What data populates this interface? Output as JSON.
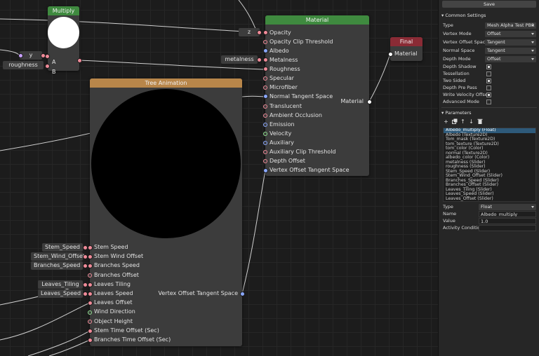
{
  "nodes": {
    "multiply": {
      "title": "Multiply",
      "inputs": [
        "A",
        "B"
      ],
      "header_color": "#3f8a3f"
    },
    "material": {
      "title": "Material",
      "header_color": "#3f8a3f",
      "inputs": [
        "Opacity",
        "Opacity Clip Threshold",
        "Albedo",
        "Metalness",
        "Roughness",
        "Specular",
        "Microfiber",
        "Normal Tangent Space",
        "Translucent",
        "Ambient Occlusion",
        "Emission",
        "Velocity",
        "Auxiliary",
        "Auxiliary Clip Threshold",
        "Depth Offset",
        "Vertex Offset Tangent Space"
      ],
      "output": "Material"
    },
    "final": {
      "title": "Final",
      "header_color": "#8a2b35",
      "input": "Material"
    },
    "tree_animation": {
      "title": "Tree Animation",
      "header_color": "#b8864a",
      "inputs": [
        "Stem Speed",
        "Stem Wind Offset",
        "Branches Speed",
        "Branches Offset",
        "Leaves Tiling",
        "Leaves Speed",
        "Leaves Offset",
        "Wind Direction",
        "Object Height",
        "Stem Time Offset (Sec)",
        "Branches Time Offset (Sec)"
      ],
      "output": "Vertex Offset Tangent Space"
    }
  },
  "param_nodes": {
    "z": "z",
    "y": "y",
    "roughness": "roughness",
    "metalness": "metalness",
    "stem_speed": "Stem_Speed",
    "stem_wind_offset": "Stem_Wind_Offset",
    "branches_speed": "Branches_Speed",
    "leaves_tiling": "Leaves_Tiling",
    "leaves_speed": "Leaves_Speed"
  },
  "panel": {
    "save_label": "Save",
    "common_settings_label": "Common Settings",
    "properties": [
      {
        "label": "Type",
        "value": "Mesh Alpha Test PBR"
      },
      {
        "label": "Vertex Mode",
        "value": "Offset"
      },
      {
        "label": "Vertex Offset Space",
        "value": "Tangent"
      },
      {
        "label": "Normal Space",
        "value": "Tangent"
      },
      {
        "label": "Depth Mode",
        "value": "Offset"
      }
    ],
    "checkboxes": [
      {
        "label": "Depth Shadow",
        "checked": true
      },
      {
        "label": "Tessellation",
        "checked": false
      },
      {
        "label": "Two Sided",
        "checked": true
      },
      {
        "label": "Depth Pre Pass",
        "checked": false
      },
      {
        "label": "Write Velocity Offset",
        "checked": true
      },
      {
        "label": "Advanced Mode",
        "checked": false
      }
    ],
    "parameters_label": "Parameters",
    "toolbar_icons": [
      "add-icon",
      "duplicate-icon",
      "arrow-up-icon",
      "arrow-down-icon",
      "trash-icon"
    ],
    "parameter_list": [
      "Albedo_multiply (Float)",
      "Albedo (Texture2D)",
      "Tom_mask (Texture2D)",
      "tom_texture (Texture2D)",
      "tom_color (Color)",
      "normal (Texture2D)",
      "albedo_color (Color)",
      "metalness (Slider)",
      "roughness (Slider)",
      "Stem_Speed (Slider)",
      "Stem_Wind_Offset (Slider)",
      "Branches_Speed (Slider)",
      "Branches_Offset (Slider)",
      "Leaves_Tiling (Slider)",
      "Leaves_Speed (Slider)",
      "Leaves_Offset (Slider)"
    ],
    "selected_parameter": {
      "type_label": "Type",
      "type_value": "Float",
      "name_label": "Name",
      "name_value": "Albedo_multiply",
      "value_label": "Value",
      "value_value": "1.0",
      "activity_label": "Activity Condition",
      "activity_value": ""
    }
  }
}
